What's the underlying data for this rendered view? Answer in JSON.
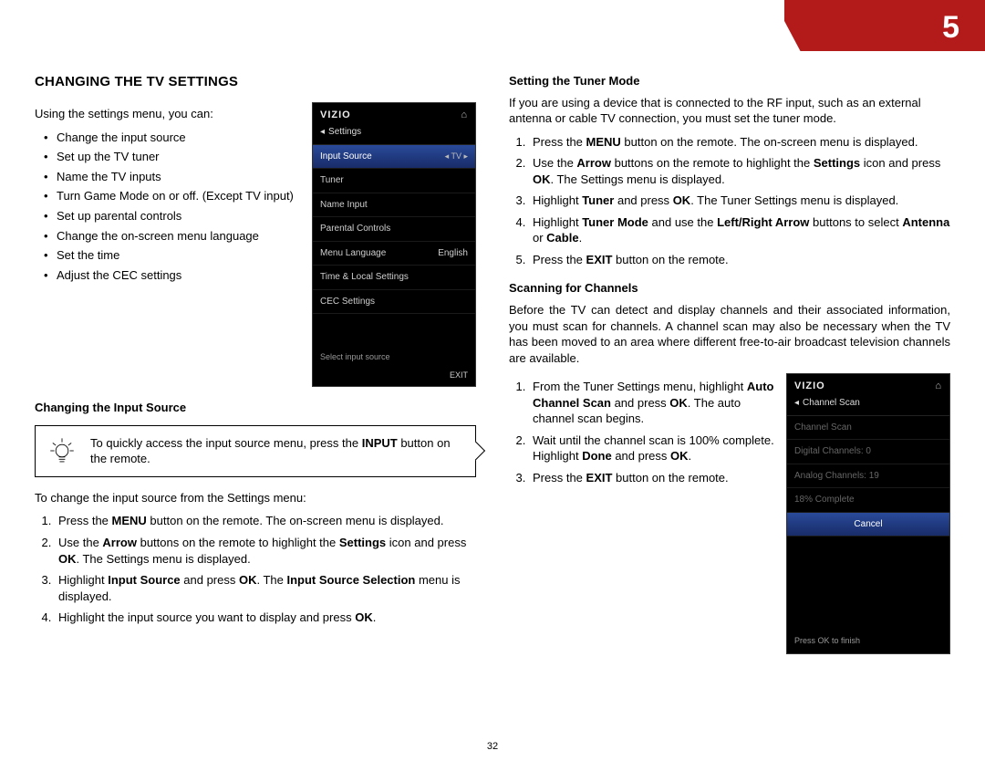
{
  "chapter_number": "5",
  "page_number": "32",
  "left": {
    "title": "CHANGING THE TV SETTINGS",
    "intro": "Using the settings menu, you can:",
    "bullets": [
      "Change the input source",
      "Set up the TV tuner",
      "Name the TV inputs",
      "Turn Game Mode on or off. (Except TV input)",
      "Set up parental controls",
      "Change the on-screen menu language",
      "Set the time",
      "Adjust the CEC settings"
    ],
    "sub1_title": "Changing the Input Source",
    "tip_html": "To quickly access the input source menu, press the <b>INPUT</b> button on the remote.",
    "change_intro": "To change the input source from the Settings menu:",
    "steps": [
      "Press the <b>MENU</b> button on the remote. The on-screen menu is displayed.",
      "Use the <b>Arrow</b> buttons on the remote to highlight the <b>Settings</b> icon and press <b>OK</b>. The Settings menu is displayed.",
      "Highlight <b>Input Source</b> and press <b>OK</b>. The <b>Input Source Selection</b> menu is displayed.",
      "Highlight the input source you want to display and press <b>OK</b>."
    ],
    "phone": {
      "brand": "VIZIO",
      "crumb_back": "◂",
      "crumb_label": "Settings",
      "rows": [
        {
          "label": "Input Source",
          "value": "◂ TV ▸",
          "selected": true
        },
        {
          "label": "Tuner",
          "value": ""
        },
        {
          "label": "Name Input",
          "value": ""
        },
        {
          "label": "Parental Controls",
          "value": ""
        },
        {
          "label": "Menu Language",
          "value": "English"
        },
        {
          "label": "Time & Local Settings",
          "value": ""
        },
        {
          "label": "CEC Settings",
          "value": ""
        }
      ],
      "hint": "Select input source",
      "exit": "EXIT"
    }
  },
  "right": {
    "sub1_title": "Setting the Tuner Mode",
    "sub1_intro": "If you are using a device that is connected to the RF input, such as an external antenna or cable TV connection, you must set the tuner mode.",
    "sub1_steps": [
      "Press the <b>MENU</b> button on the remote. The on-screen menu is displayed.",
      "Use the <b>Arrow</b> buttons on the remote to highlight the <b>Settings</b> icon and press <b>OK</b>. The Settings menu is displayed.",
      "Highlight <b>Tuner</b> and press <b>OK</b>. The Tuner Settings menu is displayed.",
      "Highlight <b>Tuner Mode</b> and use the <b>Left/Right Arrow</b> buttons to select <b>Antenna</b> or <b>Cable</b>.",
      "Press the <b>EXIT</b> button on the remote."
    ],
    "sub2_title": "Scanning for Channels",
    "sub2_intro": "Before the TV can detect and display channels and their associated information, you must scan for channels. A channel scan may also be necessary when the TV has been moved to an area where different free-to-air broadcast television channels are available.",
    "sub2_steps": [
      "From the Tuner Settings menu, highlight <b>Auto Channel Scan</b> and press <b>OK</b>. The auto channel scan begins.",
      "Wait until the channel scan is 100% complete. Highlight <b>Done</b> and press <b>OK</b>.",
      "Press the <b>EXIT</b> button on the remote."
    ],
    "phone": {
      "brand": "VIZIO",
      "crumb_back": "◂",
      "crumb_label": "Channel Scan",
      "rows": [
        {
          "label": "Channel Scan",
          "dim": true
        },
        {
          "label": "Digital Channels: 0",
          "dim": true
        },
        {
          "label": "Analog Channels: 19",
          "dim": true
        },
        {
          "label": "18%  Complete",
          "dim": true
        }
      ],
      "cancel": "Cancel",
      "hint": "Press OK to finish"
    }
  }
}
